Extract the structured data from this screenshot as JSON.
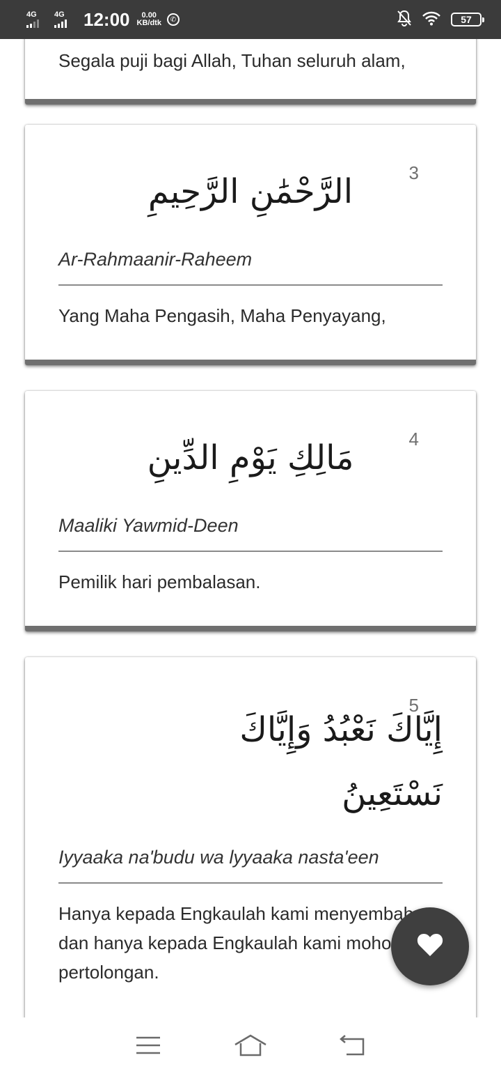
{
  "status_bar": {
    "network_1": "4G",
    "network_2": "4G",
    "time": "12:00",
    "speed_value": "0.00",
    "speed_unit": "KB/dtk",
    "battery": "57"
  },
  "verses": [
    {
      "translation": "Segala puji bagi Allah, Tuhan seluruh alam,"
    },
    {
      "number": "3",
      "arabic": "الرَّحْمَٰنِ الرَّحِيمِ",
      "transliteration": "Ar-Rahmaanir-Raheem",
      "translation": "Yang Maha Pengasih, Maha Penyayang,"
    },
    {
      "number": "4",
      "arabic": "مَالِكِ يَوْمِ الدِّينِ",
      "transliteration": "Maaliki Yawmid-Deen",
      "translation": "Pemilik hari pembalasan."
    },
    {
      "number": "5",
      "arabic_line1": "إِيَّاكَ نَعْبُدُ وَإِيَّاكَ",
      "arabic_line2": "نَسْتَعِينُ",
      "transliteration": "Iyyaaka na'budu wa lyyaaka nasta'een",
      "translation_lines": [
        "Hanya kepada Engkaulah kami menyembah",
        "dan hanya kepada Engkaulah kami mohon",
        "pertolongan."
      ]
    }
  ],
  "icons": {
    "fab": "heart-icon",
    "nav": [
      "menu-icon",
      "home-icon",
      "back-icon"
    ]
  },
  "colors": {
    "status_bar": "#3b3b3b",
    "fab": "#3f3f3f",
    "card_shadow": "#6f6f6f"
  }
}
